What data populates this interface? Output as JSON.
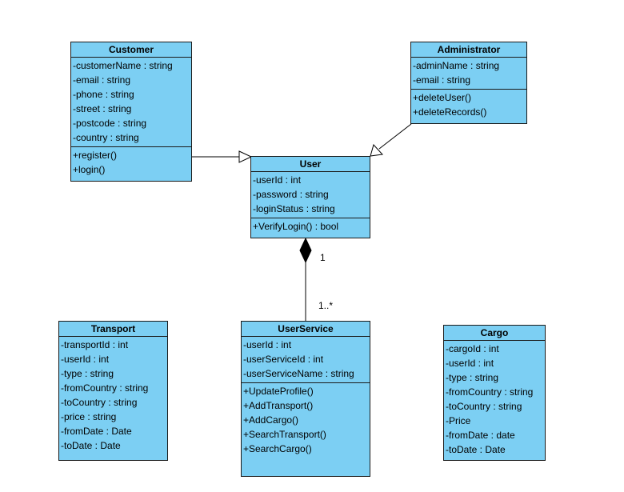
{
  "diagram": {
    "type": "UML class diagram",
    "classes": {
      "customer": {
        "name": "Customer",
        "attributes": [
          "-customerName : string",
          "-email : string",
          "-phone : string",
          "-street : string",
          "-postcode : string",
          "-country : string"
        ],
        "methods": [
          "+register()",
          "+login()"
        ]
      },
      "administrator": {
        "name": "Administrator",
        "attributes": [
          "-adminName : string",
          "-email : string"
        ],
        "methods": [
          "+deleteUser()",
          "+deleteRecords()"
        ]
      },
      "user": {
        "name": "User",
        "attributes": [
          "-userId : int",
          "-password : string",
          "-loginStatus : string"
        ],
        "methods": [
          "+VerifyLogin() : bool"
        ]
      },
      "transport": {
        "name": "Transport",
        "attributes": [
          "-transportId : int",
          "-userId : int",
          "-type : string",
          "-fromCountry : string",
          "-toCountry : string",
          "-price : string",
          "-fromDate : Date",
          "-toDate : Date"
        ],
        "methods": []
      },
      "userservice": {
        "name": "UserService",
        "attributes": [
          "-userId : int",
          "-userServiceId : int",
          "-userServiceName : string"
        ],
        "methods": [
          "+UpdateProfile()",
          "+AddTransport()",
          "+AddCargo()",
          "+SearchTransport()",
          "+SearchCargo()"
        ]
      },
      "cargo": {
        "name": "Cargo",
        "attributes": [
          "-cargoId : int",
          "-userId : int",
          "-type : string",
          "-fromCountry : string",
          "-toCountry : string",
          "-Price",
          "-fromDate : date",
          "-toDate : Date"
        ],
        "methods": []
      }
    },
    "relationships": [
      {
        "type": "generalization",
        "from": "Customer",
        "to": "User"
      },
      {
        "type": "generalization",
        "from": "Administrator",
        "to": "User"
      },
      {
        "type": "composition",
        "whole": "User",
        "part": "UserService",
        "whole_multiplicity": "1",
        "part_multiplicity": "1..*"
      }
    ],
    "colors": {
      "class_fill": "#7ccff3",
      "border": "#1a1a1a",
      "background": "#ffffff"
    }
  }
}
